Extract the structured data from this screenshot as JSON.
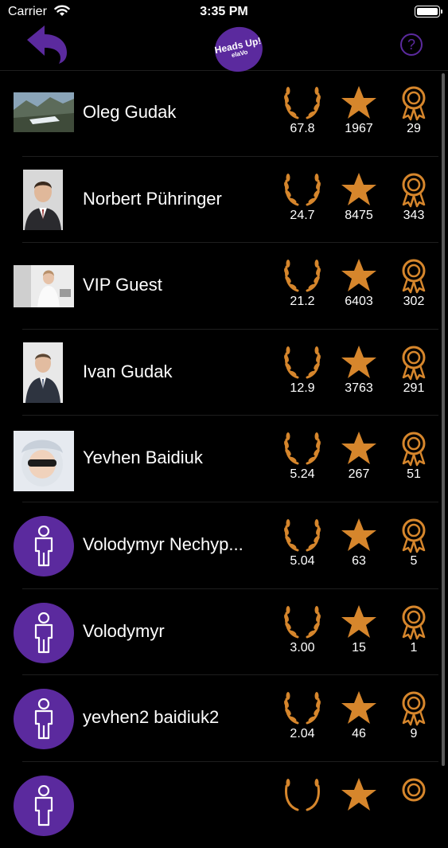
{
  "status_bar": {
    "carrier": "Carrier",
    "time": "3:35 PM"
  },
  "header": {
    "logo_line1": "Heads Up!",
    "logo_line2": "elaVo",
    "help_symbol": "?"
  },
  "colors": {
    "accent_purple": "#5b2a9e",
    "icon_orange": "#d6862c",
    "background": "#000000"
  },
  "icons": [
    "back-arrow-icon",
    "help-icon",
    "laurel-wreath-icon",
    "star-icon",
    "ribbon-medal-icon",
    "person-icon"
  ],
  "players": [
    {
      "name": "Oleg Gudak",
      "rating": "67.8",
      "stars": "1967",
      "awards": "29",
      "avatar": "photo"
    },
    {
      "name": "Norbert Pühringer",
      "rating": "24.7",
      "stars": "8475",
      "awards": "343",
      "avatar": "photo"
    },
    {
      "name": "VIP Guest",
      "rating": "21.2",
      "stars": "6403",
      "awards": "302",
      "avatar": "photo"
    },
    {
      "name": "Ivan Gudak",
      "rating": "12.9",
      "stars": "3763",
      "awards": "291",
      "avatar": "photo"
    },
    {
      "name": "Yevhen Baidiuk",
      "rating": "5.24",
      "stars": "267",
      "awards": "51",
      "avatar": "photo"
    },
    {
      "name": "Volodymyr Nechyp...",
      "rating": "5.04",
      "stars": "63",
      "awards": "5",
      "avatar": "default"
    },
    {
      "name": "Volodymyr",
      "rating": "3.00",
      "stars": "15",
      "awards": "1",
      "avatar": "default"
    },
    {
      "name": "yevhen2 baidiuk2",
      "rating": "2.04",
      "stars": "46",
      "awards": "9",
      "avatar": "default"
    }
  ]
}
